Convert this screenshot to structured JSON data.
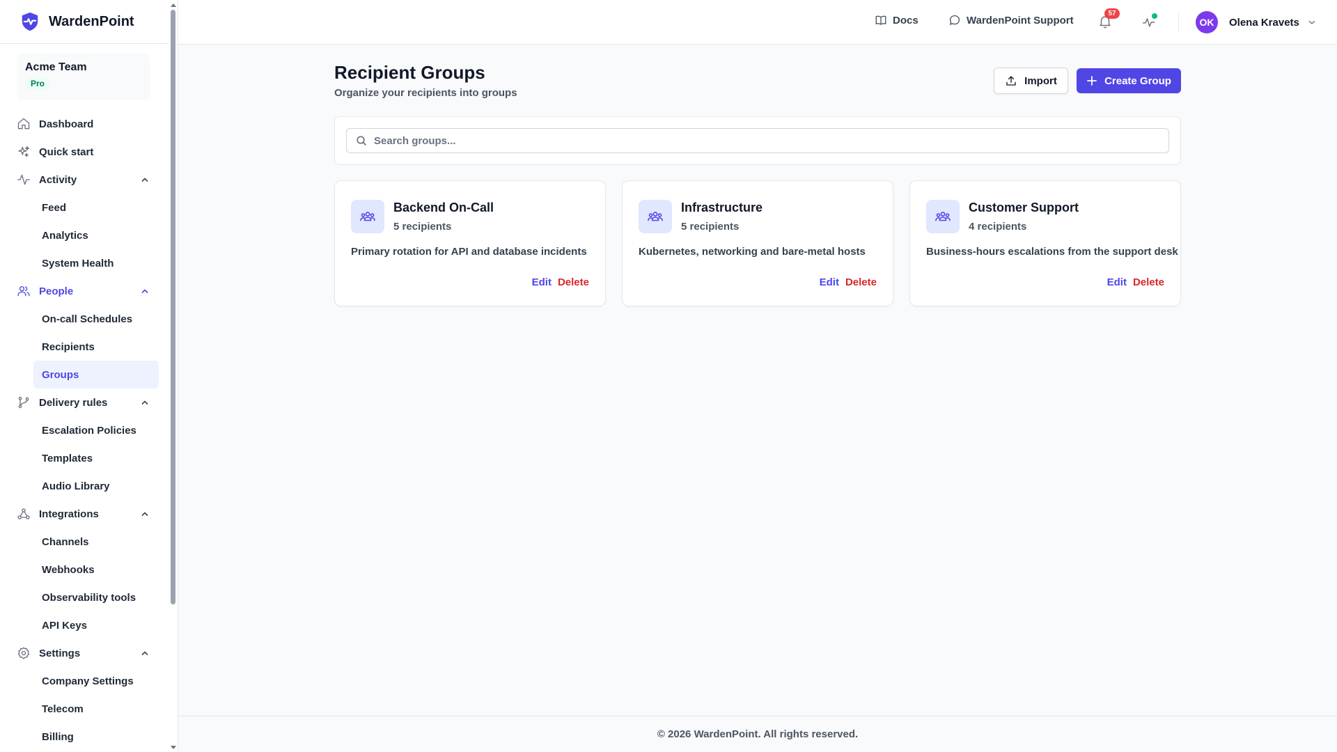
{
  "app": {
    "name": "WardenPoint"
  },
  "team": {
    "name": "Acme Team",
    "plan": "Pro"
  },
  "sidebar": {
    "items": [
      {
        "label": "Dashboard",
        "icon": "home-icon"
      },
      {
        "label": "Quick start",
        "icon": "sparkles-icon"
      },
      {
        "label": "Activity",
        "icon": "activity-icon",
        "expanded": true,
        "children": [
          "Feed",
          "Analytics",
          "System Health"
        ]
      },
      {
        "label": "People",
        "icon": "users-icon",
        "expanded": true,
        "active": true,
        "children": [
          "On-call Schedules",
          "Recipients",
          "Groups"
        ],
        "active_child": "Groups"
      },
      {
        "label": "Delivery rules",
        "icon": "git-branch-icon",
        "expanded": true,
        "children": [
          "Escalation Policies",
          "Templates",
          "Audio Library"
        ]
      },
      {
        "label": "Integrations",
        "icon": "webhook-icon",
        "expanded": true,
        "children": [
          "Channels",
          "Webhooks",
          "Observability tools",
          "API Keys"
        ]
      },
      {
        "label": "Settings",
        "icon": "gear-icon",
        "expanded": true,
        "children": [
          "Company Settings",
          "Telecom",
          "Billing"
        ]
      }
    ]
  },
  "topbar": {
    "docs_label": "Docs",
    "support_label": "WardenPoint Support",
    "notification_count": "57",
    "status_color": "#10b981",
    "user": {
      "initials": "OK",
      "name": "Olena Kravets"
    }
  },
  "main": {
    "title": "Recipient Groups",
    "subtitle": "Organize your recipients into groups",
    "import_label": "Import",
    "create_label": "Create Group",
    "search_placeholder": "Search groups...",
    "groups": [
      {
        "name": "Backend On-Call",
        "count": "5 recipients",
        "description": "Primary rotation for API and database incidents"
      },
      {
        "name": "Infrastructure",
        "count": "5 recipients",
        "description": "Kubernetes, networking and bare-metal hosts"
      },
      {
        "name": "Customer Support",
        "count": "4 recipients",
        "description": "Business-hours escalations from the support desk"
      }
    ],
    "edit_label": "Edit",
    "delete_label": "Delete"
  },
  "footer": {
    "text": "© 2026 WardenPoint. All rights reserved."
  },
  "colors": {
    "accent": "#4f46e5",
    "danger": "#dc2626",
    "plan_badge": "#047857"
  }
}
